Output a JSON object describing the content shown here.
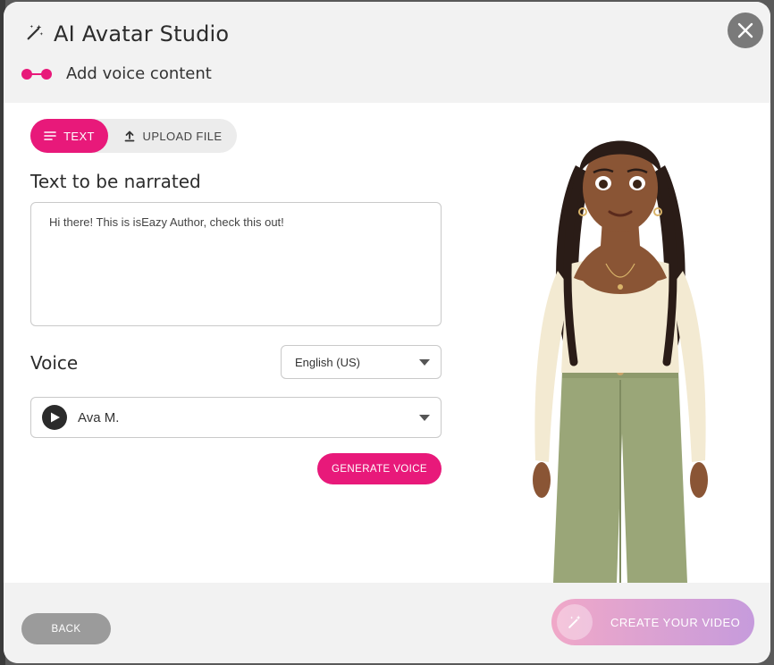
{
  "header": {
    "title": "AI Avatar Studio",
    "step_label": "Add voice content"
  },
  "tabs": [
    {
      "label": "TEXT",
      "active": true
    },
    {
      "label": "UPLOAD FILE",
      "active": false
    }
  ],
  "narration": {
    "label": "Text to be narrated",
    "value": "Hi there! This is isEazy Author, check this out!"
  },
  "voice": {
    "label": "Voice",
    "language": "English (US)",
    "selected_voice": "Ava M."
  },
  "buttons": {
    "generate": "GENERATE VOICE",
    "back": "BACK",
    "create": "CREATE YOUR VIDEO"
  },
  "colors": {
    "accent": "#e8197a",
    "create_gradient_start": "#f0a8c8",
    "create_gradient_end": "#c69bdc"
  },
  "icons": [
    "magic-wand-icon",
    "close-icon",
    "lines-icon",
    "upload-icon",
    "play-icon",
    "chevron-down-icon"
  ]
}
